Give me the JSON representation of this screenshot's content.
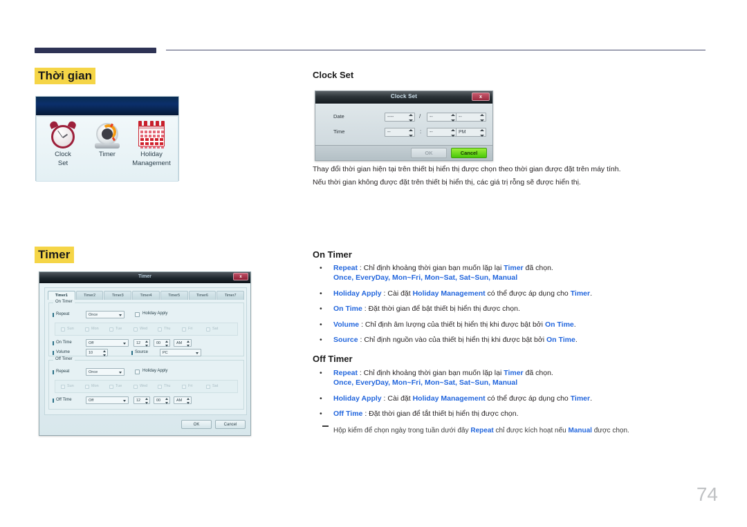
{
  "header": {
    "rule_color": "#2e3355"
  },
  "page": {
    "number": "74"
  },
  "sections": {
    "time_heading": "Thời gian",
    "timer_heading": "Timer"
  },
  "icon_panel": {
    "items": [
      {
        "icon": "alarm-clock-icon",
        "caption_line1": "Clock",
        "caption_line2": "Set"
      },
      {
        "icon": "kitchen-timer-icon",
        "caption_line1": "Timer",
        "caption_line2": ""
      },
      {
        "icon": "calendar-icon",
        "caption_line1": "Holiday",
        "caption_line2": "Management"
      }
    ]
  },
  "clock_set": {
    "heading": "Clock Set",
    "dialog": {
      "title": "Clock Set",
      "close_label": "x",
      "rows": [
        {
          "label": "Date",
          "fields": [
            "----",
            "--",
            "--"
          ],
          "separators": [
            "/",
            "/"
          ]
        },
        {
          "label": "Time",
          "fields": [
            "--",
            "--",
            "PM"
          ],
          "separators": [
            ":"
          ]
        }
      ],
      "ok_label": "OK",
      "cancel_label": "Cancel"
    },
    "paragraph_1": "Thay đổi thời gian hiện tại trên thiết bị hiển thị được chọn theo thời gian được đặt trên máy tính.",
    "paragraph_2": "Nếu thời gian không được đặt trên thiết bị hiển thị, các giá trị rỗng sẽ được hiển thị."
  },
  "timer_dialog": {
    "title": "Timer",
    "close_label": "x",
    "tabs": [
      {
        "label": "Timer1",
        "active": true
      },
      {
        "label": "Timer2",
        "active": false
      },
      {
        "label": "Timer3",
        "active": false
      },
      {
        "label": "Timer4",
        "active": false
      },
      {
        "label": "Timer5",
        "active": false
      },
      {
        "label": "Timer6",
        "active": false
      },
      {
        "label": "Timer7",
        "active": false
      }
    ],
    "on_group": {
      "legend": "On Timer",
      "repeat_label": "Repeat",
      "repeat_value": "Once",
      "holiday_apply_label": "Holiday Apply",
      "days": [
        "Sun",
        "Mon",
        "Tue",
        "Wed",
        "Thu",
        "Fri",
        "Sat"
      ],
      "time_label": "On Time",
      "time_mode": "Off",
      "hour": "12",
      "minute": "00",
      "meridiem": "AM",
      "volume_label": "Volume",
      "volume_value": "10",
      "source_label": "Source",
      "source_value": "PC"
    },
    "off_group": {
      "legend": "Off Timer",
      "repeat_label": "Repeat",
      "repeat_value": "Once",
      "holiday_apply_label": "Holiday Apply",
      "days": [
        "Sun",
        "Mon",
        "Tue",
        "Wed",
        "Thu",
        "Fri",
        "Sat"
      ],
      "time_label": "Off Time",
      "time_mode": "Off",
      "hour": "12",
      "minute": "00",
      "meridiem": "AM"
    },
    "ok_label": "OK",
    "cancel_label": "Cancel"
  },
  "on_timer": {
    "heading": "On Timer",
    "bullets": [
      {
        "term": "Repeat",
        "sep": " : ",
        "body_a": "Chỉ định khoảng thời gian bạn muốn lặp lại ",
        "term_b": "Timer",
        "body_b": " đã chọn.",
        "options": "Once, EveryDay, Mon~Fri, Mon~Sat, Sat~Sun, Manual"
      },
      {
        "term": "Holiday Apply",
        "sep": " : ",
        "body_a": "Cài đặt ",
        "term_b": "Holiday Management",
        "body_b": " có thể được áp dụng cho ",
        "term_c": "Timer",
        "body_c": "."
      },
      {
        "term": "On Time",
        "sep": " : ",
        "body_a": "Đặt thời gian để bật thiết bị hiển thị được chọn."
      },
      {
        "term": "Volume",
        "sep": " : ",
        "body_a": "Chỉ định âm lượng của thiết bị hiển thị khi được bật bởi ",
        "term_b": "On Time",
        "body_b": "."
      },
      {
        "term": "Source",
        "sep": " : ",
        "body_a": "Chỉ định nguồn vào của thiết bị hiển thị khi được bật bởi ",
        "term_b": "On Time",
        "body_b": "."
      }
    ]
  },
  "off_timer": {
    "heading": "Off Timer",
    "bullets": [
      {
        "term": "Repeat",
        "sep": " : ",
        "body_a": "Chỉ định khoảng thời gian bạn muốn lặp lại ",
        "term_b": "Timer",
        "body_b": " đã chọn.",
        "options": "Once, EveryDay, Mon~Fri, Mon~Sat, Sat~Sun, Manual"
      },
      {
        "term": "Holiday Apply",
        "sep": " : ",
        "body_a": "Cài đặt ",
        "term_b": "Holiday Management",
        "body_b": " có thể được áp dụng cho ",
        "term_c": "Timer",
        "body_c": "."
      },
      {
        "term": "Off Time",
        "sep": " : ",
        "body_a": "Đặt thời gian để tắt thiết bị hiển thị được chọn."
      }
    ],
    "note": {
      "part_a": "Hộp kiểm để chọn ngày trong tuần dưới đây ",
      "term_a": "Repeat",
      "part_b": " chỉ được kích hoạt nếu ",
      "term_b": "Manual",
      "part_c": " được chọn."
    }
  }
}
